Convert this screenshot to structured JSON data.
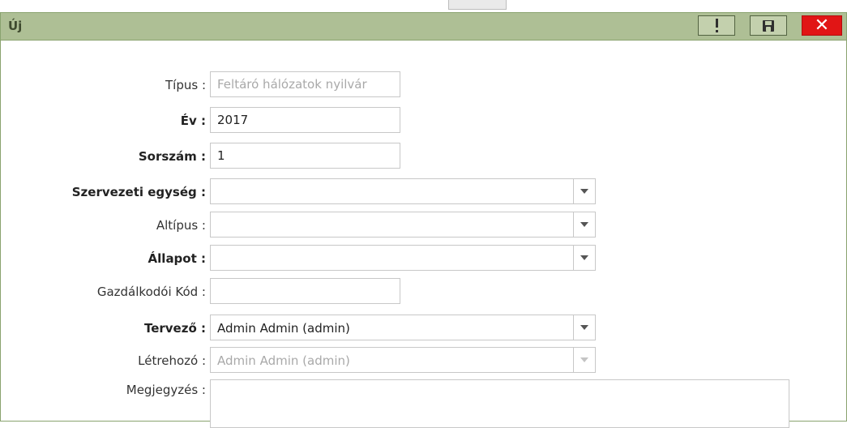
{
  "window": {
    "title": "Új",
    "buttons": {
      "alert_icon": "exclamation-icon",
      "save_icon": "save-disk-icon",
      "close_icon": "close-icon",
      "close_glyph": "✕"
    },
    "colors": {
      "titlebar": "#aebf95",
      "close_button": "#e11515"
    }
  },
  "form": {
    "fields": [
      {
        "label": "Típus :",
        "value": "Feltáró hálózatok nyilvár",
        "required": false,
        "kind": "text",
        "disabled": true
      },
      {
        "label": "Év :",
        "value": "2017",
        "required": true,
        "kind": "text",
        "disabled": false
      },
      {
        "label": "Sorszám :",
        "value": "1",
        "required": true,
        "kind": "text",
        "disabled": false
      },
      {
        "label": "Szervezeti egység :",
        "value": "",
        "required": true,
        "kind": "combo",
        "disabled": false
      },
      {
        "label": "Altípus :",
        "value": "",
        "required": false,
        "kind": "combo",
        "disabled": false
      },
      {
        "label": "Állapot :",
        "value": "",
        "required": true,
        "kind": "combo",
        "disabled": false
      },
      {
        "label": "Gazdálkodói Kód :",
        "value": "",
        "required": false,
        "kind": "text",
        "disabled": false
      },
      {
        "label": "Tervező :",
        "value": "Admin Admin (admin)",
        "required": true,
        "kind": "combo",
        "disabled": false
      },
      {
        "label": "Létrehozó :",
        "value": "Admin Admin (admin)",
        "required": false,
        "kind": "combo",
        "disabled": true
      },
      {
        "label": "Megjegyzés :",
        "value": "",
        "required": false,
        "kind": "textarea",
        "disabled": false
      }
    ]
  }
}
